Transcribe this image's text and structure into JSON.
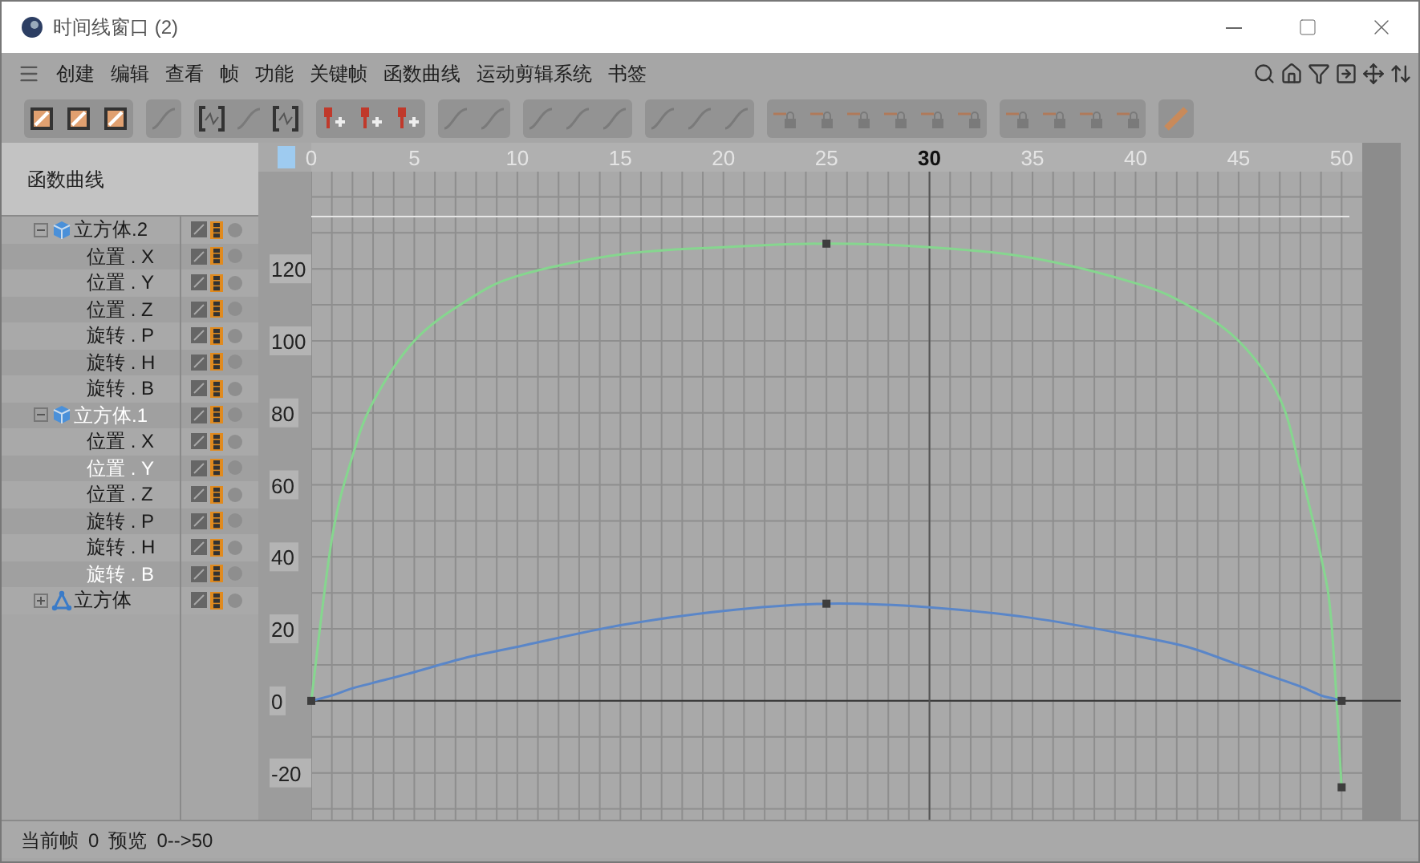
{
  "window": {
    "title": "时间线窗口 (2)"
  },
  "menu": [
    "创建",
    "编辑",
    "查看",
    "帧",
    "功能",
    "关键帧",
    "函数曲线",
    "运动剪辑系统",
    "书签"
  ],
  "panel_title": "函数曲线",
  "tree": [
    {
      "label": "立方体.2",
      "kind": "cube",
      "expanded": true,
      "selected": false,
      "children": [
        {
          "label": "位置 . X",
          "selected": false
        },
        {
          "label": "位置 . Y",
          "selected": false
        },
        {
          "label": "位置 . Z",
          "selected": false
        },
        {
          "label": "旋转 . P",
          "selected": false
        },
        {
          "label": "旋转 . H",
          "selected": false
        },
        {
          "label": "旋转 . B",
          "selected": false
        }
      ]
    },
    {
      "label": "立方体.1",
      "kind": "cube",
      "expanded": true,
      "selected": true,
      "children": [
        {
          "label": "位置 . X",
          "selected": false
        },
        {
          "label": "位置 . Y",
          "selected": true
        },
        {
          "label": "位置 . Z",
          "selected": false
        },
        {
          "label": "旋转 . P",
          "selected": false
        },
        {
          "label": "旋转 . H",
          "selected": false
        },
        {
          "label": "旋转 . B",
          "selected": true
        }
      ]
    },
    {
      "label": "立方体",
      "kind": "joint",
      "expanded": false,
      "selected": false
    }
  ],
  "graph": {
    "chart_data": {
      "type": "line",
      "x": [
        0,
        1,
        2,
        3,
        5,
        7.5,
        10,
        15,
        20,
        25,
        30,
        35,
        40,
        42.5,
        45,
        47,
        48,
        49,
        49.5,
        50
      ],
      "series": [
        {
          "color": "#86d68f",
          "values": [
            0,
            45,
            68,
            83,
            100,
            111,
            118,
            124,
            126,
            127,
            126,
            123,
            116,
            110,
            100,
            84,
            64,
            40,
            22,
            -24
          ]
        },
        {
          "color": "#5a86c8",
          "values": [
            0,
            1.5,
            3.5,
            5,
            8,
            12,
            15,
            21,
            25,
            27,
            26,
            23,
            18,
            15,
            10,
            6,
            4,
            1.5,
            0.8,
            0
          ]
        }
      ],
      "xlim": [
        0,
        51
      ],
      "ylim": [
        -33,
        147
      ],
      "grid": true,
      "ref_lines": [
        {
          "axis": "x",
          "value": 30
        }
      ],
      "xticks": [
        0,
        5,
        10,
        15,
        20,
        25,
        30,
        35,
        40,
        45,
        50
      ],
      "yticks": [
        -20,
        0,
        20,
        40,
        60,
        80,
        100,
        120
      ]
    }
  },
  "status_bar": {
    "frame_label": "当前帧",
    "frame": "0",
    "preview_label": "预览",
    "preview": "0-->50"
  }
}
